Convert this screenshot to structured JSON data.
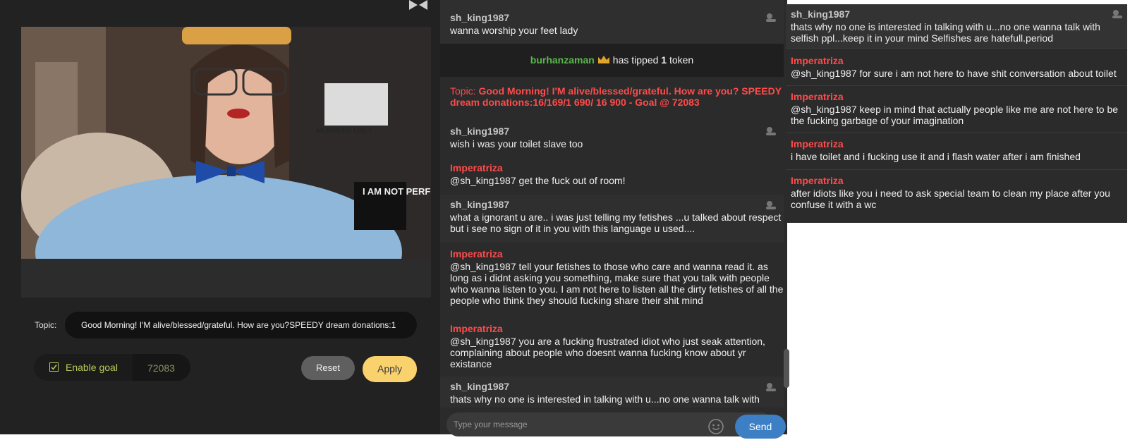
{
  "stream": {
    "topic_label": "Topic:",
    "topic_value": "Good Morning! I'M alive/blessed/grateful. How are you?SPEEDY dream donations:1",
    "enable_goal_label": "Enable goal",
    "goal_value": "72083",
    "reset_label": "Reset",
    "apply_label": "Apply",
    "video_text": "I AM NOT PERFECT",
    "video_text_partial": "MEMBERS ONLY"
  },
  "chat": {
    "messages": [
      {
        "user": "sh_king1987",
        "text": "wanna worship your feet lady"
      },
      {
        "user": "sh_king1987",
        "text": "wish i was your toilet slave too"
      },
      {
        "user": "Imperatriza",
        "text": "@sh_king1987 get the fuck out of room!"
      },
      {
        "user": "sh_king1987",
        "text": "what a ignorant u are.. i was just telling my fetishes ...u talked about respect but i see no sign of it in you with this language u used...."
      },
      {
        "user": "Imperatriza",
        "text": "@sh_king1987 tell your fetishes to those who care and wanna read it. as long as i didnt asking you something, make sure that you talk with people who wanna listen to you. I am not here to listen all the dirty fetishes of all the people who think they should fucking share their shit mind"
      },
      {
        "user": "Imperatriza",
        "text": "@sh_king1987 you are a fucking frustrated idiot who just seak attention, complaining about people who doesnt wanna fucking know about yr existance"
      },
      {
        "user": "sh_king1987",
        "text": "thats why no one is interested in talking with u...no one wanna talk with"
      }
    ],
    "tip": {
      "user": "burhanzaman",
      "text_before": "has tipped",
      "amount": "1",
      "unit": "token"
    },
    "topic": {
      "label": "Topic:",
      "text": "Good Morning! I'M alive/blessed/grateful. How are you? SPEEDY dream donations:16/169/1 690/ 16 900 - Goal @ 72083"
    },
    "input_placeholder": "Type your message",
    "send_label": "Send"
  },
  "popout": {
    "messages": [
      {
        "user": "sh_king1987",
        "text": "thats why no one is interested in talking with u...no one wanna talk with selfish ppl...keep it in your mind Selfishes are hatefull.period"
      },
      {
        "user": "Imperatriza",
        "text": "@sh_king1987 for sure i am not here to have shit conversation about toilet"
      },
      {
        "user": "Imperatriza",
        "text": "@sh_king1987 keep in mind that actually people like me are not here to be the fucking garbage of your imagination"
      },
      {
        "user": "Imperatriza",
        "text": "i have toilet and i fucking use it and i flash water after i am finished"
      },
      {
        "user": "Imperatriza",
        "text": "after idiots like you i need to ask special team to clean my place after you confuse it with a wc"
      }
    ]
  },
  "colors": {
    "model_name": "#ff4b4b",
    "tipper": "#5ab84b",
    "apply": "#f9d26d",
    "send": "#3d7fc4"
  }
}
